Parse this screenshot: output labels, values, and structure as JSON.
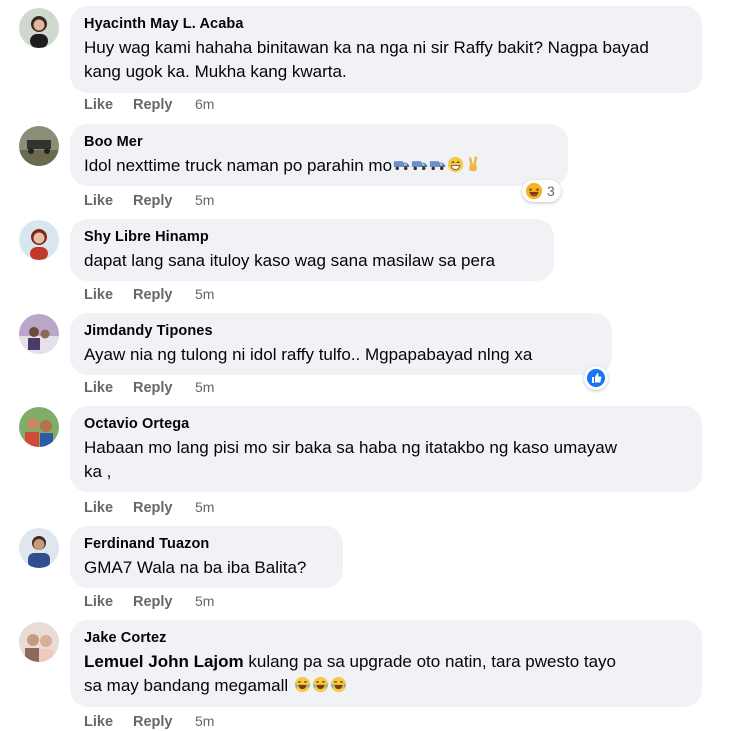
{
  "colors": {
    "bubble_bg": "#f0f2f5",
    "meta_text": "#65676b",
    "like_blue": "#1877f2",
    "haha_yellow": "#f7b125"
  },
  "comments": [
    {
      "author": "Hyacinth May L. Acaba",
      "text": "Huy wag kami hahaha binitawan ka na nga ni sir Raffy bakit? Nagpa bayad kang ugok ka. Mukha kang kwarta.",
      "like": "Like",
      "reply": "Reply",
      "time": "6m"
    },
    {
      "author": "Boo Mer",
      "text": "Idol nexttime truck naman po parahin mo",
      "emojis": [
        "truck-emoji",
        "truck-emoji",
        "truck-emoji",
        "grin-emoji",
        "victory-hand-emoji"
      ],
      "reaction": {
        "icon": "haha-reaction-icon",
        "count": "3"
      },
      "like": "Like",
      "reply": "Reply",
      "time": "5m"
    },
    {
      "author": "Shy Libre Hinamp",
      "text": "dapat lang sana ituloy kaso wag sana masilaw sa pera",
      "like": "Like",
      "reply": "Reply",
      "time": "5m"
    },
    {
      "author": "Jimdandy Tipones",
      "text": "Ayaw nia ng tulong ni idol raffy tulfo.. Mgpapabayad nlng xa",
      "reaction": {
        "icon": "like-reaction-icon"
      },
      "like": "Like",
      "reply": "Reply",
      "time": "5m"
    },
    {
      "author": "Octavio Ortega",
      "text_line1": "Habaan mo lang pisi mo sir baka sa haba ng itatakbo ng kaso umayaw",
      "text_line2": "ka ,",
      "like": "Like",
      "reply": "Reply",
      "time": "5m"
    },
    {
      "author": "Ferdinand Tuazon",
      "text": "GMA7 Wala na ba iba Balita?",
      "like": "Like",
      "reply": "Reply",
      "time": "5m"
    },
    {
      "author": "Jake Cortez",
      "mention": "Lemuel John Lajom",
      "text_line1": " kulang pa sa upgrade oto natin, tara pwesto tayo",
      "text_line2": "sa may bandang megamall",
      "emojis": [
        "tears-of-joy-emoji",
        "tears-of-joy-emoji",
        "tears-of-joy-emoji"
      ],
      "like": "Like",
      "reply": "Reply",
      "time": "5m"
    }
  ]
}
